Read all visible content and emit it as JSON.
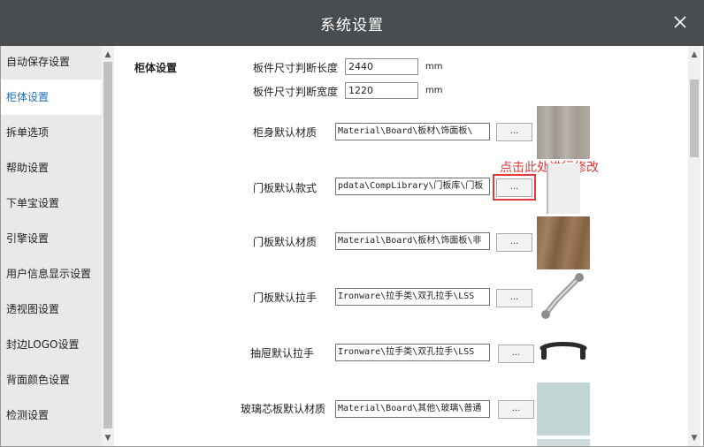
{
  "window": {
    "title": "系统设置"
  },
  "sidebar": {
    "items": [
      {
        "label": "自动保存设置",
        "active": false
      },
      {
        "label": "柜体设置",
        "active": true
      },
      {
        "label": "拆单选项",
        "active": false
      },
      {
        "label": "帮助设置",
        "active": false
      },
      {
        "label": "下单宝设置",
        "active": false
      },
      {
        "label": "引擎设置",
        "active": false
      },
      {
        "label": "用户信息显示设置",
        "active": false
      },
      {
        "label": "透视图设置",
        "active": false
      },
      {
        "label": "封边LOGO设置",
        "active": false
      },
      {
        "label": "背面颜色设置",
        "active": false
      },
      {
        "label": "检测设置",
        "active": false
      },
      {
        "label": "...",
        "active": false
      }
    ]
  },
  "main": {
    "section_title": "柜体设置",
    "board_length": {
      "label": "板件尺寸判断长度",
      "value": "2440",
      "unit": "mm"
    },
    "board_width": {
      "label": "板件尺寸判断宽度",
      "value": "1220",
      "unit": "mm"
    },
    "rows": [
      {
        "label": "柜身默认材质",
        "value": "Material\\Board\\板材\\饰面板\\",
        "button": "...",
        "icon": "wood-grey-swatch"
      },
      {
        "label": "门板默认款式",
        "value": "pdata\\CompLibrary\\门板库\\门板",
        "button": "...",
        "icon": "door-panel-swatch"
      },
      {
        "label": "门板默认材质",
        "value": "Material\\Board\\板材\\饰面板\\非",
        "button": "...",
        "icon": "wood-brown-swatch"
      },
      {
        "label": "门板默认拉手",
        "value": "Ironware\\拉手类\\双孔拉手\\LSS",
        "button": "...",
        "icon": "silver-handle-icon"
      },
      {
        "label": "抽屉默认拉手",
        "value": "Ironware\\拉手类\\双孔拉手\\LSS",
        "button": "...",
        "icon": "black-handle-icon"
      },
      {
        "label": "玻璃芯板默认材质",
        "value": "Material\\Board\\其他\\玻璃\\普通",
        "button": "...",
        "icon": "glass-swatch"
      }
    ],
    "annotation": "点击此处进行修改"
  },
  "colors": {
    "titlebar": "#4a4d50",
    "accent": "#1a6fc9",
    "annotation": "#e03a3a"
  }
}
